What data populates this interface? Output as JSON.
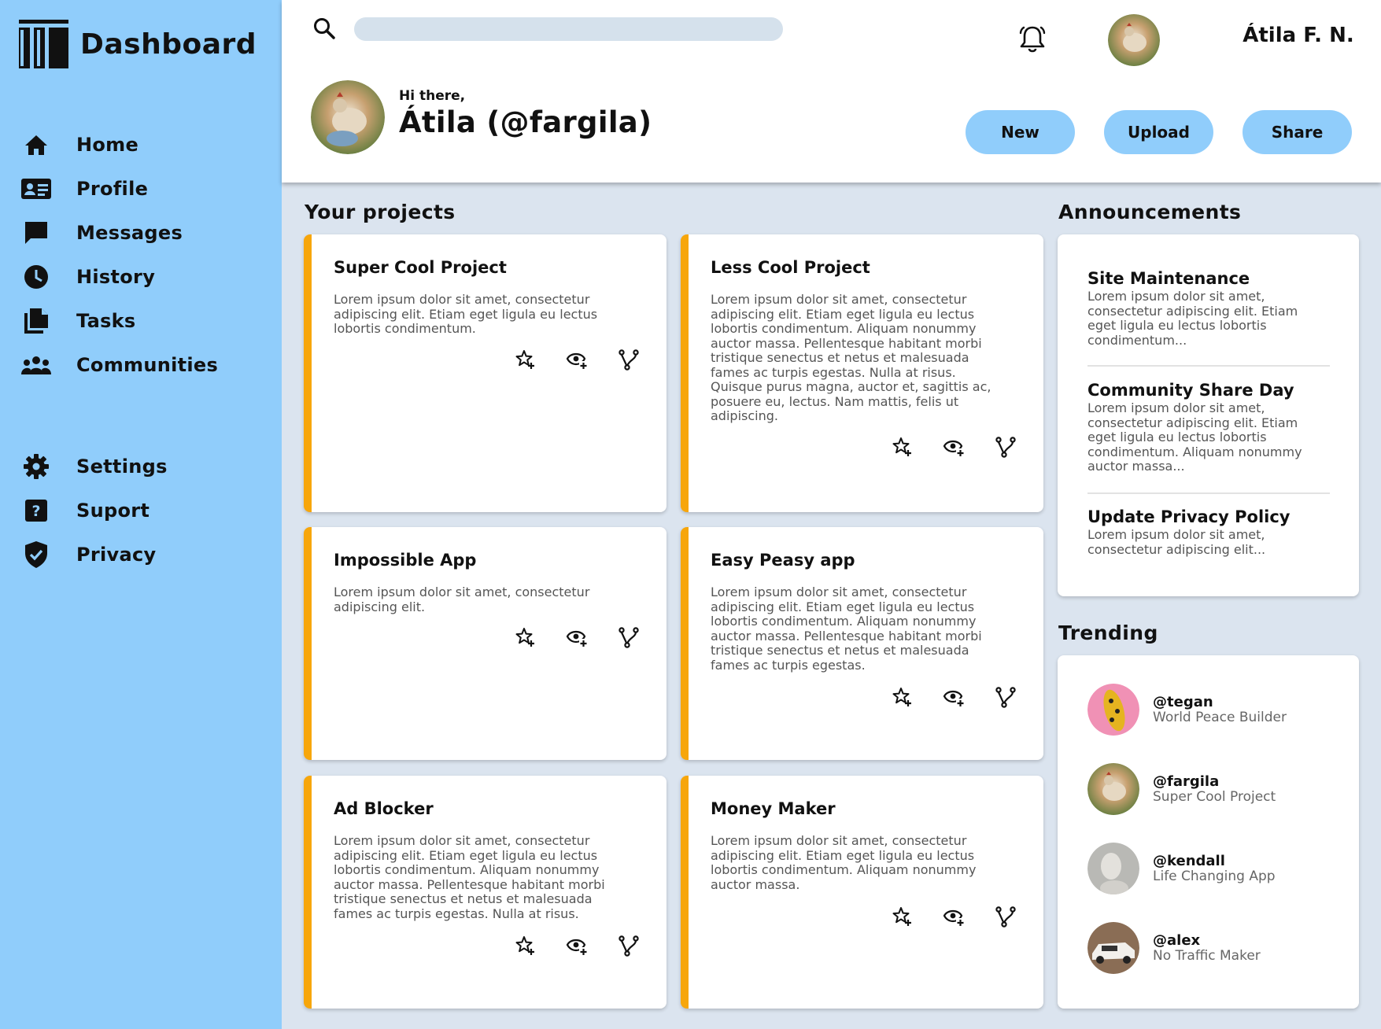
{
  "app": {
    "title": "Dashboard",
    "logo_icon": "library-columns-icon"
  },
  "sidebar": {
    "main_items": [
      {
        "label": "Home",
        "icon": "home-icon"
      },
      {
        "label": "Profile",
        "icon": "id-card-icon"
      },
      {
        "label": "Messages",
        "icon": "chat-bubble-icon"
      },
      {
        "label": "History",
        "icon": "clock-icon"
      },
      {
        "label": "Tasks",
        "icon": "documents-icon"
      },
      {
        "label": "Communities",
        "icon": "people-group-icon"
      }
    ],
    "secondary_items": [
      {
        "label": "Settings",
        "icon": "gear-icon"
      },
      {
        "label": "Suport",
        "icon": "help-icon"
      },
      {
        "label": "Privacy",
        "icon": "shield-check-icon"
      }
    ]
  },
  "header": {
    "search": {
      "value": "",
      "placeholder": ""
    },
    "username": "Átila F. N.",
    "greeting": "Hi there,",
    "full_name": "Átila (@fargila)",
    "actions": {
      "new": "New",
      "upload": "Upload",
      "share": "Share"
    }
  },
  "projects": {
    "title": "Your projects",
    "items": [
      {
        "title": "Super Cool Project",
        "description": "Lorem ipsum dolor sit amet, consectetur adipiscing elit. Etiam eget ligula eu lectus lobortis condimentum."
      },
      {
        "title": "Less Cool Project",
        "description": "Lorem ipsum dolor sit amet, consectetur adipiscing elit. Etiam eget ligula eu lectus lobortis condimentum. Aliquam nonummy auctor massa. Pellentesque habitant morbi tristique senectus et netus et malesuada fames ac turpis egestas. Nulla at risus. Quisque purus magna, auctor et, sagittis ac, posuere eu, lectus. Nam mattis, felis ut adipiscing."
      },
      {
        "title": "Impossible App",
        "description": "Lorem ipsum dolor sit amet, consectetur adipiscing elit."
      },
      {
        "title": "Easy Peasy app",
        "description": "Lorem ipsum dolor sit amet, consectetur adipiscing elit. Etiam eget ligula eu lectus lobortis condimentum. Aliquam nonummy auctor massa. Pellentesque habitant morbi tristique senectus et netus et malesuada fames ac turpis egestas."
      },
      {
        "title": "Ad Blocker",
        "description": "Lorem ipsum dolor sit amet, consectetur adipiscing elit. Etiam eget ligula eu lectus lobortis condimentum. Aliquam nonummy auctor massa. Pellentesque habitant morbi tristique senectus et netus et malesuada fames ac turpis egestas. Nulla at risus."
      },
      {
        "title": "Money Maker",
        "description": "Lorem ipsum dolor sit amet, consectetur adipiscing elit. Etiam eget ligula eu lectus lobortis condimentum. Aliquam nonummy auctor massa."
      }
    ],
    "card_icons": [
      "star-add-icon",
      "watch-eye-icon",
      "fork-icon"
    ]
  },
  "announcements": {
    "title": "Announcements",
    "items": [
      {
        "title": "Site Maintenance",
        "body": "Lorem ipsum dolor sit amet, consectetur adipiscing elit. Etiam eget ligula eu lectus lobortis condimentum..."
      },
      {
        "title": "Community Share Day",
        "body": "Lorem ipsum dolor sit amet, consectetur adipiscing elit. Etiam eget ligula eu lectus lobortis condimentum. Aliquam nonummy auctor massa..."
      },
      {
        "title": "Update Privacy Policy",
        "body": "Lorem ipsum dolor sit amet, consectetur adipiscing elit..."
      }
    ]
  },
  "trending": {
    "title": "Trending",
    "items": [
      {
        "handle": "@tegan",
        "project": "World Peace Builder"
      },
      {
        "handle": "@fargila",
        "project": "Super Cool Project"
      },
      {
        "handle": "@kendall",
        "project": "Life Changing App"
      },
      {
        "handle": "@alex",
        "project": "No Traffic Maker"
      }
    ]
  },
  "colors": {
    "sidebar": "#90cdfb",
    "accent": "#f7a60b",
    "button": "#90cdfb",
    "background": "#dbe4ef"
  }
}
